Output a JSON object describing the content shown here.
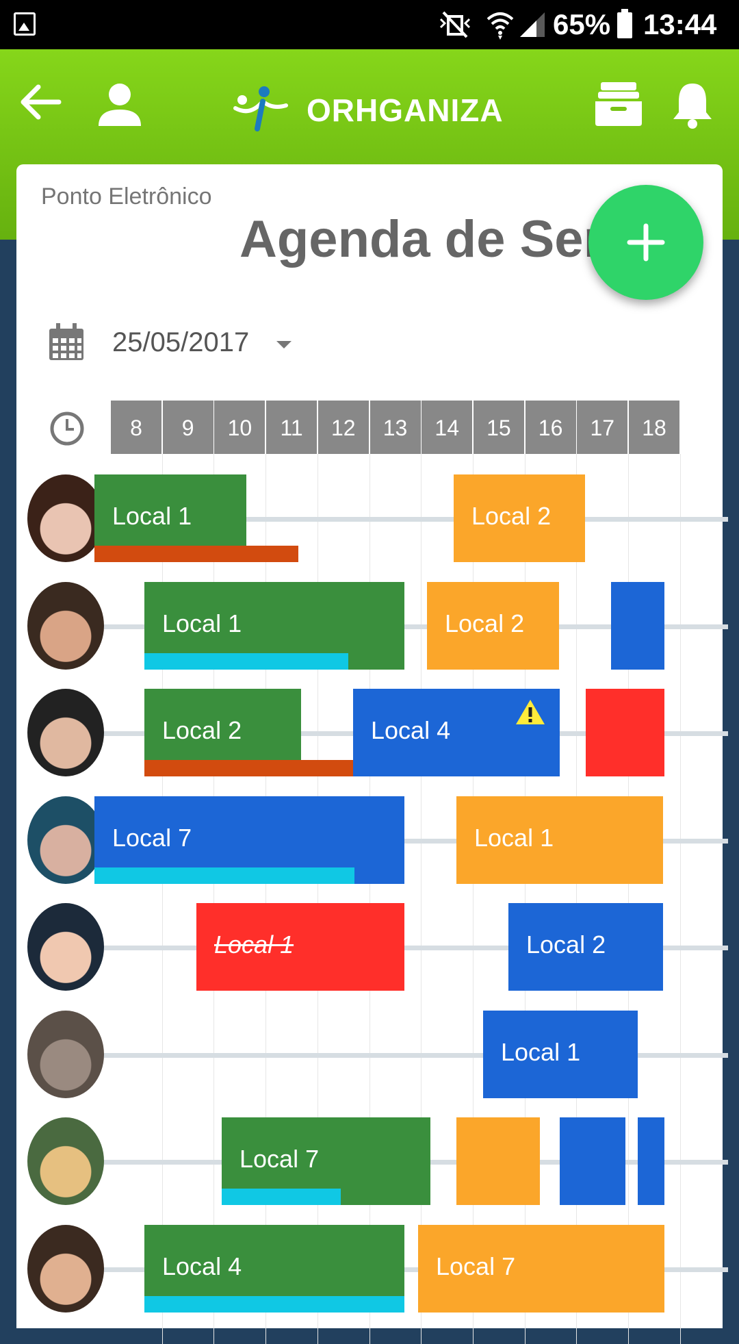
{
  "status_bar": {
    "battery": "65%",
    "time": "13:44"
  },
  "header": {
    "logo_text": "ORHGANIZA"
  },
  "page": {
    "breadcrumb": "Ponto Eletrônico",
    "title": "Agenda de Ser"
  },
  "date_picker": {
    "value": "25/05/2017"
  },
  "hours": [
    "8",
    "9",
    "10",
    "11",
    "12",
    "13",
    "14",
    "15",
    "16",
    "17",
    "18"
  ],
  "colors": {
    "green": "#3a8f3d",
    "orange": "#fba62a",
    "blue": "#1c66d6",
    "red": "#ff2f2a",
    "rust": "#d24b0f",
    "cyan": "#10c8e4",
    "fab": "#2fd469"
  },
  "schedule": [
    {
      "blocks": [
        {
          "label": "Local 1",
          "color": "green"
        },
        {
          "label": "Local 2",
          "color": "orange"
        }
      ]
    },
    {
      "blocks": [
        {
          "label": "Local 1",
          "color": "green"
        },
        {
          "label": "Local 2",
          "color": "orange"
        },
        {
          "label": "",
          "color": "blue"
        }
      ]
    },
    {
      "blocks": [
        {
          "label": "Local 2",
          "color": "green"
        },
        {
          "label": "Local 4",
          "color": "blue",
          "warning": true
        },
        {
          "label": "",
          "color": "red"
        }
      ]
    },
    {
      "blocks": [
        {
          "label": "Local 7",
          "color": "blue"
        },
        {
          "label": "Local 1",
          "color": "orange"
        }
      ]
    },
    {
      "blocks": [
        {
          "label": "Local 1",
          "color": "red",
          "cancelled": true
        },
        {
          "label": "Local 2",
          "color": "blue"
        }
      ]
    },
    {
      "blocks": [
        {
          "label": "Local 1",
          "color": "blue"
        }
      ]
    },
    {
      "blocks": [
        {
          "label": "Local 7",
          "color": "green"
        },
        {
          "label": "",
          "color": "orange"
        },
        {
          "label": "",
          "color": "blue"
        },
        {
          "label": "",
          "color": "blue"
        }
      ]
    },
    {
      "blocks": [
        {
          "label": "Local 4",
          "color": "green"
        },
        {
          "label": "Local 7",
          "color": "orange"
        }
      ]
    }
  ]
}
